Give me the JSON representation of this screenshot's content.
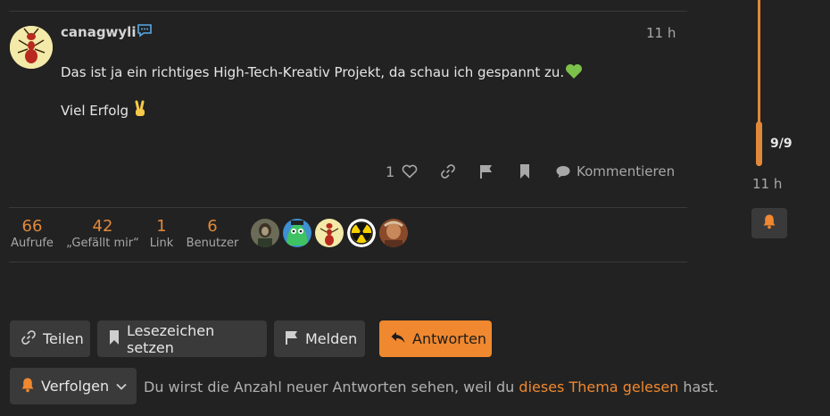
{
  "post": {
    "username": "canagwyli",
    "time": "11 h",
    "line1": "Das ist ja ein richtiges High-Tech-Kreativ Projekt, da schau ich gespannt zu.",
    "line2": "Viel Erfolg",
    "like_count": "1",
    "comment_label": "Kommentieren"
  },
  "stats": [
    {
      "value": "66",
      "label": "Aufrufe"
    },
    {
      "value": "42",
      "label": "„Gefällt mir“"
    },
    {
      "value": "1",
      "label": "Link"
    },
    {
      "value": "6",
      "label": "Benutzer"
    }
  ],
  "timeline": {
    "count": "9/9",
    "time": "11 h"
  },
  "buttons": {
    "share": "Teilen",
    "bookmark": "Lesezeichen setzen",
    "flag": "Melden",
    "reply": "Antworten",
    "notify": "Verfolgen"
  },
  "notification": {
    "prefix": "Du wirst die Anzahl neuer Antworten sehen, weil du",
    "link": "dieses Thema gelesen",
    "suffix": "hast."
  },
  "colors": {
    "accent": "#f0882f",
    "background": "#222222"
  }
}
